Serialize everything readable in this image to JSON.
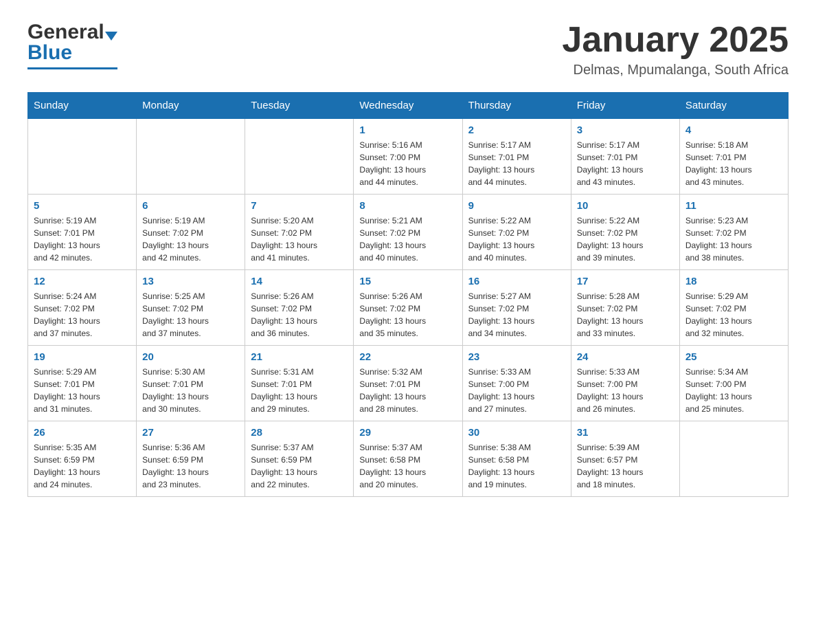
{
  "header": {
    "logo": {
      "general": "General",
      "blue": "Blue",
      "arrow": "▼"
    },
    "title": "January 2025",
    "location": "Delmas, Mpumalanga, South Africa"
  },
  "calendar": {
    "weekdays": [
      "Sunday",
      "Monday",
      "Tuesday",
      "Wednesday",
      "Thursday",
      "Friday",
      "Saturday"
    ],
    "weeks": [
      [
        {
          "day": "",
          "info": ""
        },
        {
          "day": "",
          "info": ""
        },
        {
          "day": "",
          "info": ""
        },
        {
          "day": "1",
          "info": "Sunrise: 5:16 AM\nSunset: 7:00 PM\nDaylight: 13 hours\nand 44 minutes."
        },
        {
          "day": "2",
          "info": "Sunrise: 5:17 AM\nSunset: 7:01 PM\nDaylight: 13 hours\nand 44 minutes."
        },
        {
          "day": "3",
          "info": "Sunrise: 5:17 AM\nSunset: 7:01 PM\nDaylight: 13 hours\nand 43 minutes."
        },
        {
          "day": "4",
          "info": "Sunrise: 5:18 AM\nSunset: 7:01 PM\nDaylight: 13 hours\nand 43 minutes."
        }
      ],
      [
        {
          "day": "5",
          "info": "Sunrise: 5:19 AM\nSunset: 7:01 PM\nDaylight: 13 hours\nand 42 minutes."
        },
        {
          "day": "6",
          "info": "Sunrise: 5:19 AM\nSunset: 7:02 PM\nDaylight: 13 hours\nand 42 minutes."
        },
        {
          "day": "7",
          "info": "Sunrise: 5:20 AM\nSunset: 7:02 PM\nDaylight: 13 hours\nand 41 minutes."
        },
        {
          "day": "8",
          "info": "Sunrise: 5:21 AM\nSunset: 7:02 PM\nDaylight: 13 hours\nand 40 minutes."
        },
        {
          "day": "9",
          "info": "Sunrise: 5:22 AM\nSunset: 7:02 PM\nDaylight: 13 hours\nand 40 minutes."
        },
        {
          "day": "10",
          "info": "Sunrise: 5:22 AM\nSunset: 7:02 PM\nDaylight: 13 hours\nand 39 minutes."
        },
        {
          "day": "11",
          "info": "Sunrise: 5:23 AM\nSunset: 7:02 PM\nDaylight: 13 hours\nand 38 minutes."
        }
      ],
      [
        {
          "day": "12",
          "info": "Sunrise: 5:24 AM\nSunset: 7:02 PM\nDaylight: 13 hours\nand 37 minutes."
        },
        {
          "day": "13",
          "info": "Sunrise: 5:25 AM\nSunset: 7:02 PM\nDaylight: 13 hours\nand 37 minutes."
        },
        {
          "day": "14",
          "info": "Sunrise: 5:26 AM\nSunset: 7:02 PM\nDaylight: 13 hours\nand 36 minutes."
        },
        {
          "day": "15",
          "info": "Sunrise: 5:26 AM\nSunset: 7:02 PM\nDaylight: 13 hours\nand 35 minutes."
        },
        {
          "day": "16",
          "info": "Sunrise: 5:27 AM\nSunset: 7:02 PM\nDaylight: 13 hours\nand 34 minutes."
        },
        {
          "day": "17",
          "info": "Sunrise: 5:28 AM\nSunset: 7:02 PM\nDaylight: 13 hours\nand 33 minutes."
        },
        {
          "day": "18",
          "info": "Sunrise: 5:29 AM\nSunset: 7:02 PM\nDaylight: 13 hours\nand 32 minutes."
        }
      ],
      [
        {
          "day": "19",
          "info": "Sunrise: 5:29 AM\nSunset: 7:01 PM\nDaylight: 13 hours\nand 31 minutes."
        },
        {
          "day": "20",
          "info": "Sunrise: 5:30 AM\nSunset: 7:01 PM\nDaylight: 13 hours\nand 30 minutes."
        },
        {
          "day": "21",
          "info": "Sunrise: 5:31 AM\nSunset: 7:01 PM\nDaylight: 13 hours\nand 29 minutes."
        },
        {
          "day": "22",
          "info": "Sunrise: 5:32 AM\nSunset: 7:01 PM\nDaylight: 13 hours\nand 28 minutes."
        },
        {
          "day": "23",
          "info": "Sunrise: 5:33 AM\nSunset: 7:00 PM\nDaylight: 13 hours\nand 27 minutes."
        },
        {
          "day": "24",
          "info": "Sunrise: 5:33 AM\nSunset: 7:00 PM\nDaylight: 13 hours\nand 26 minutes."
        },
        {
          "day": "25",
          "info": "Sunrise: 5:34 AM\nSunset: 7:00 PM\nDaylight: 13 hours\nand 25 minutes."
        }
      ],
      [
        {
          "day": "26",
          "info": "Sunrise: 5:35 AM\nSunset: 6:59 PM\nDaylight: 13 hours\nand 24 minutes."
        },
        {
          "day": "27",
          "info": "Sunrise: 5:36 AM\nSunset: 6:59 PM\nDaylight: 13 hours\nand 23 minutes."
        },
        {
          "day": "28",
          "info": "Sunrise: 5:37 AM\nSunset: 6:59 PM\nDaylight: 13 hours\nand 22 minutes."
        },
        {
          "day": "29",
          "info": "Sunrise: 5:37 AM\nSunset: 6:58 PM\nDaylight: 13 hours\nand 20 minutes."
        },
        {
          "day": "30",
          "info": "Sunrise: 5:38 AM\nSunset: 6:58 PM\nDaylight: 13 hours\nand 19 minutes."
        },
        {
          "day": "31",
          "info": "Sunrise: 5:39 AM\nSunset: 6:57 PM\nDaylight: 13 hours\nand 18 minutes."
        },
        {
          "day": "",
          "info": ""
        }
      ]
    ]
  }
}
